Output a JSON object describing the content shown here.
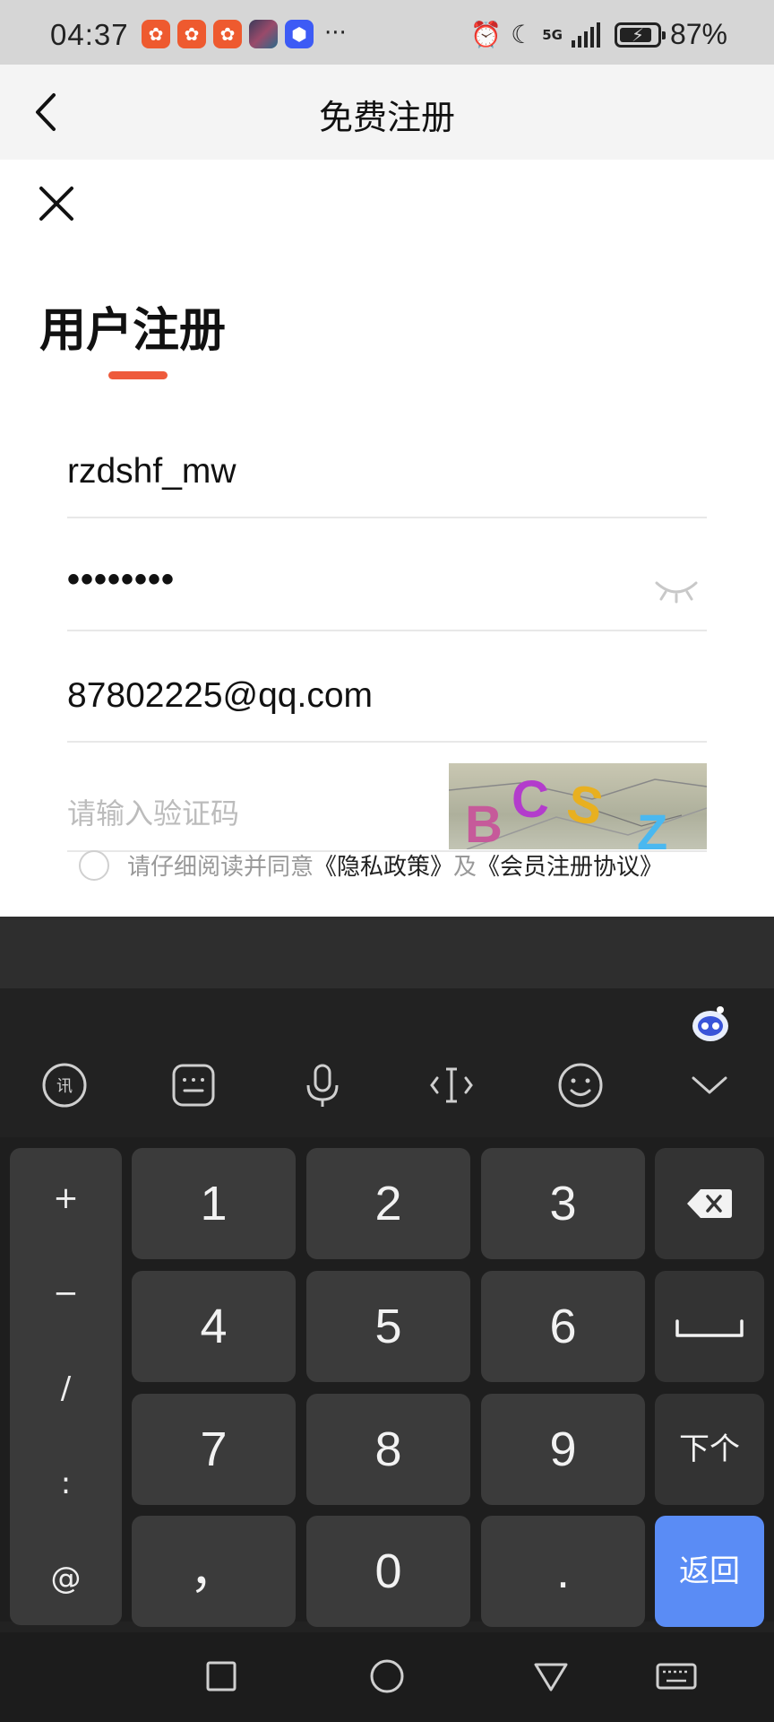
{
  "status_bar": {
    "time": "04:37",
    "app_icons": [
      "kuaishou-icon",
      "kuaishou-icon",
      "kuaishou-icon",
      "photo-thumbnail-icon",
      "cube-app-icon"
    ],
    "overflow": "···",
    "network": "5G",
    "battery_level": 0.87,
    "battery_percent": "87%"
  },
  "header": {
    "title": "免费注册"
  },
  "form": {
    "heading": "用户注册",
    "username_value": "rzdshf_mw",
    "password_value": "••••••••",
    "email_value": "87802225@qq.com",
    "code_placeholder": "请输入验证码",
    "captcha_text": "BCSZ"
  },
  "agreement": {
    "prefix": "请仔细阅读并同意",
    "privacy_link": "《隐私政策》",
    "joiner": "及",
    "terms_link": "《会员注册协议》"
  },
  "keyboard": {
    "symbols": [
      "+",
      "−",
      "/",
      ":",
      "@"
    ],
    "keys_row1": [
      "1",
      "2",
      "3"
    ],
    "keys_row2": [
      "4",
      "5",
      "6"
    ],
    "keys_row3": [
      "7",
      "8",
      "9"
    ],
    "keys_row4": [
      "，",
      "0",
      "."
    ],
    "next_label": "下个",
    "return_label": "返回",
    "accent_color": "#5a8cf5"
  },
  "colors": {
    "brand_accent": "#ee5a3b"
  }
}
